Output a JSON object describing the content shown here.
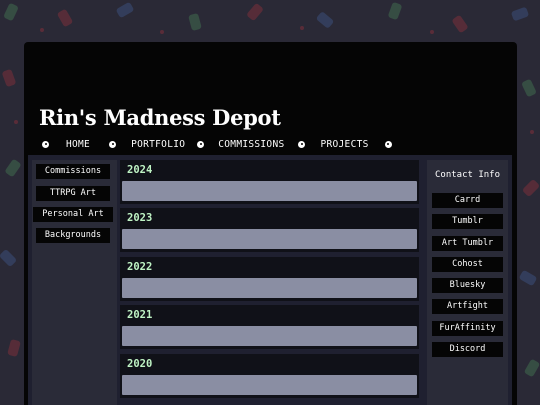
{
  "site": {
    "title": "Rin's Madness Depot"
  },
  "nav": {
    "items": [
      "HOME",
      "PORTFOLIO",
      "COMMISSIONS",
      "PROJECTS"
    ]
  },
  "left_nav": {
    "items": [
      "Commissions",
      "TTRPG Art",
      "Personal Art",
      "Backgrounds"
    ]
  },
  "years": [
    "2024",
    "2023",
    "2022",
    "2021",
    "2020"
  ],
  "contact": {
    "title": "Contact Info",
    "links": [
      "Carrd",
      "Tumblr",
      "Art Tumblr",
      "Cohost",
      "Bluesky",
      "Artfight",
      "FurAffinity",
      "Discord"
    ]
  },
  "colors": {
    "page_bg": "#2a2936",
    "panel": "#050505",
    "year_text": "#bff3c4",
    "year_bar": "#8a8ea3"
  }
}
